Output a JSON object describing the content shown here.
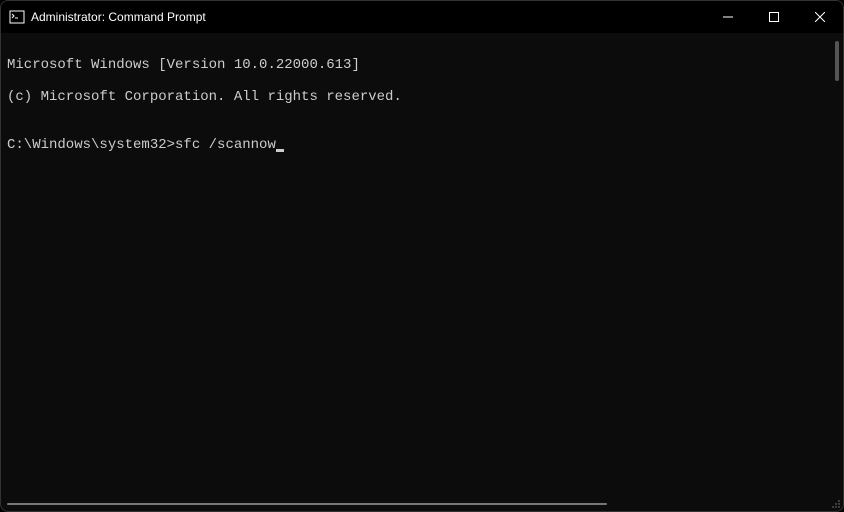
{
  "titlebar": {
    "title": "Administrator: Command Prompt"
  },
  "terminal": {
    "line1": "Microsoft Windows [Version 10.0.22000.613]",
    "line2": "(c) Microsoft Corporation. All rights reserved.",
    "blank": "",
    "prompt": "C:\\Windows\\system32>",
    "command": "sfc /scannow"
  }
}
